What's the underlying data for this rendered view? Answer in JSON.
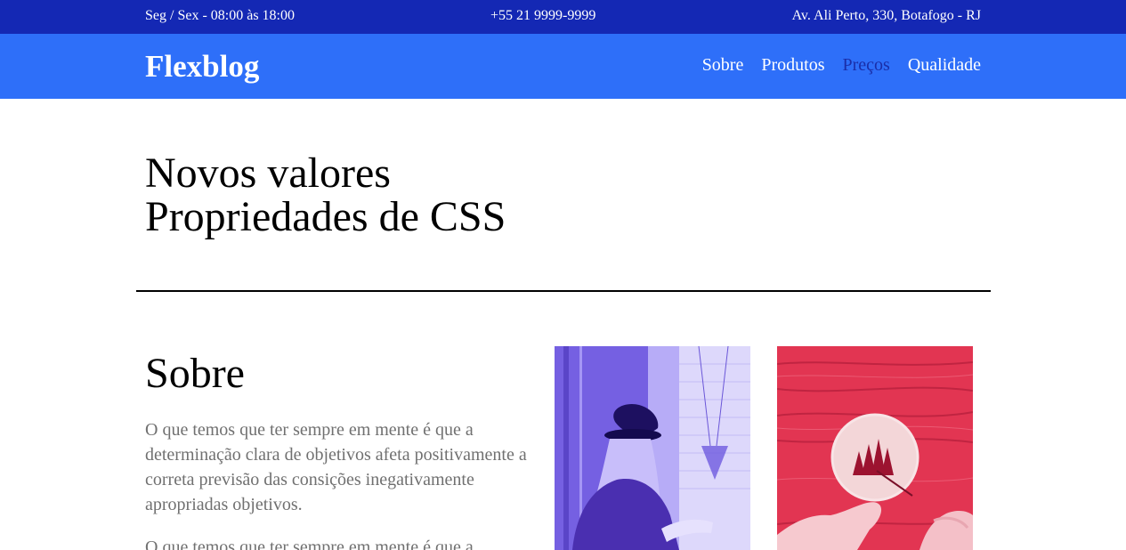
{
  "topbar": {
    "hours": "Seg / Sex - 08:00 às 18:00",
    "phone": "+55 21 9999-9999",
    "address": "Av. Ali Perto, 330, Botafogo - RJ"
  },
  "header": {
    "logo": "Flexblog",
    "nav": [
      {
        "label": "Sobre"
      },
      {
        "label": "Produtos"
      },
      {
        "label": "Preços"
      },
      {
        "label": "Qualidade"
      }
    ]
  },
  "hero": {
    "line1": "Novos valores",
    "line2": "Propriedades de CSS"
  },
  "about": {
    "title": "Sobre",
    "paragraph1": "O que temos que ter sempre em mente é que a determinação clara de objetivos afeta positivamente a correta previsão das consições inegativamente apropriadas objetivos.",
    "paragraph2": "O que temos que ter sempre em mente é que a"
  },
  "colors": {
    "topbar": "#1428b4",
    "header": "#2e6ff9",
    "nav_active": "#1a2ea8",
    "photo_one_tint": "#8a72ee",
    "photo_two_tint": "#e83655"
  }
}
